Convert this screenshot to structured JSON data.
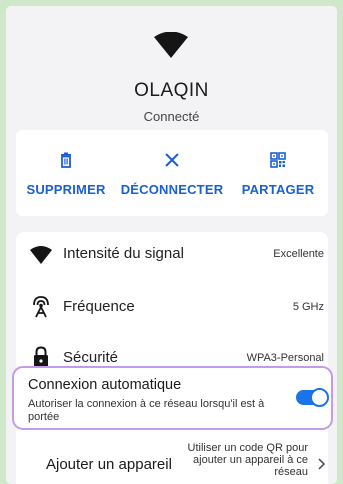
{
  "network": {
    "name": "OLAQIN",
    "status": "Connecté"
  },
  "actions": [
    {
      "label": "SUPPRIMER",
      "icon": "trash-icon"
    },
    {
      "label": "DÉCONNECTER",
      "icon": "close-icon"
    },
    {
      "label": "PARTAGER",
      "icon": "qr-code-icon"
    }
  ],
  "details": {
    "signal": {
      "label": "Intensité du signal",
      "value": "Excellente",
      "icon": "wifi-icon"
    },
    "frequency": {
      "label": "Fréquence",
      "value": "5 GHz",
      "icon": "antenna-icon"
    },
    "security": {
      "label": "Sécurité",
      "value": "WPA3-Personal",
      "icon": "lock-icon"
    }
  },
  "auto_connect": {
    "title": "Connexion automatique",
    "subtitle": "Autoriser la connexion à ce réseau lorsqu'il est à portée",
    "enabled": true
  },
  "add_device": {
    "label": "Ajouter un appareil",
    "hint": "Utiliser un code QR pour ajouter un appareil à ce réseau"
  },
  "colors": {
    "accent": "#1a73e8",
    "highlight": "#c39be8",
    "background": "#cfe8c9"
  }
}
